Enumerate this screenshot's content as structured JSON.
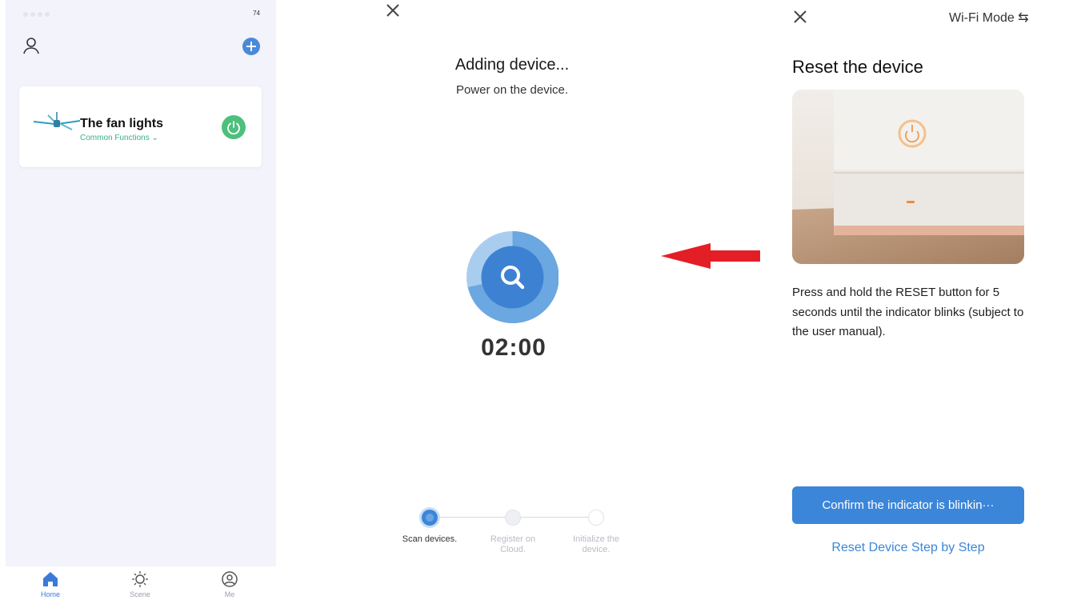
{
  "home": {
    "status_battery": "74",
    "device": {
      "name": "The fan lights",
      "subtitle": "Common Functions ⌄"
    },
    "tabs": [
      {
        "label": "Home",
        "icon": "home-icon",
        "active": true
      },
      {
        "label": "Scene",
        "icon": "sun-icon",
        "active": false
      },
      {
        "label": "Me",
        "icon": "profile-icon",
        "active": false
      }
    ]
  },
  "adding": {
    "title": "Adding device...",
    "subtitle": "Power on the device.",
    "timer": "02:00",
    "steps": [
      {
        "label": "Scan devices.",
        "state": "active"
      },
      {
        "label": "Register on Cloud.",
        "state": "pending"
      },
      {
        "label": "Initialize the device.",
        "state": "pending"
      }
    ]
  },
  "reset": {
    "mode_label": "Wi-Fi Mode ⇆",
    "title": "Reset the device",
    "instructions": "Press and hold the RESET button for 5 seconds until the indicator blinks (subject to the user manual).",
    "confirm_label": "Confirm the indicator is blinkin···",
    "link_label": "Reset Device Step by Step"
  },
  "colors": {
    "accent_blue": "#3b86d9",
    "power_green": "#4cc07c",
    "arrow_red": "#e41e26",
    "home_bg": "#f2f3fb"
  }
}
